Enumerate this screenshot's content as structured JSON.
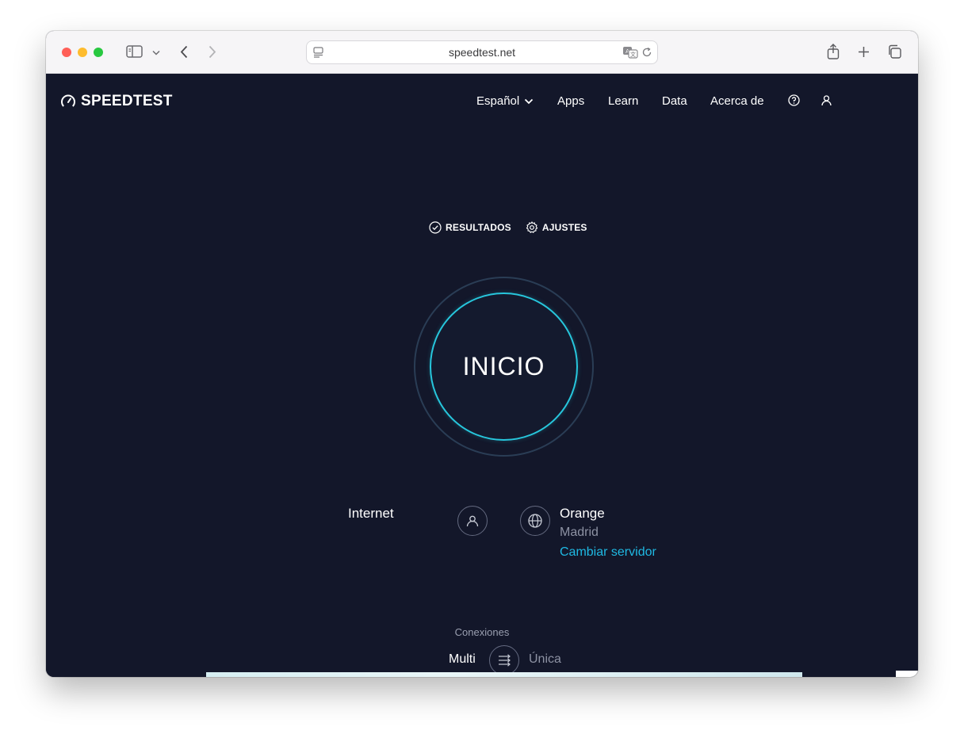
{
  "browser": {
    "url": "speedtest.net",
    "traffic_lights": [
      "#ff5f57",
      "#febc2e",
      "#28c840"
    ]
  },
  "header": {
    "logo_text": "SPEEDTEST",
    "nav": {
      "language": "Español",
      "apps": "Apps",
      "learn": "Learn",
      "data": "Data",
      "about": "Acerca de"
    }
  },
  "test": {
    "results_label": "RESULTADOS",
    "settings_label": "AJUSTES",
    "start_label": "INICIO",
    "accent_color": "#27c6dc"
  },
  "connection": {
    "client_label": "Internet",
    "isp_name": "Orange",
    "isp_city": "Madrid",
    "change_server": "Cambiar servidor",
    "link_color": "#1fb9e3"
  },
  "connections_mode": {
    "title": "Conexiones",
    "multi": "Multi",
    "single": "Única"
  }
}
